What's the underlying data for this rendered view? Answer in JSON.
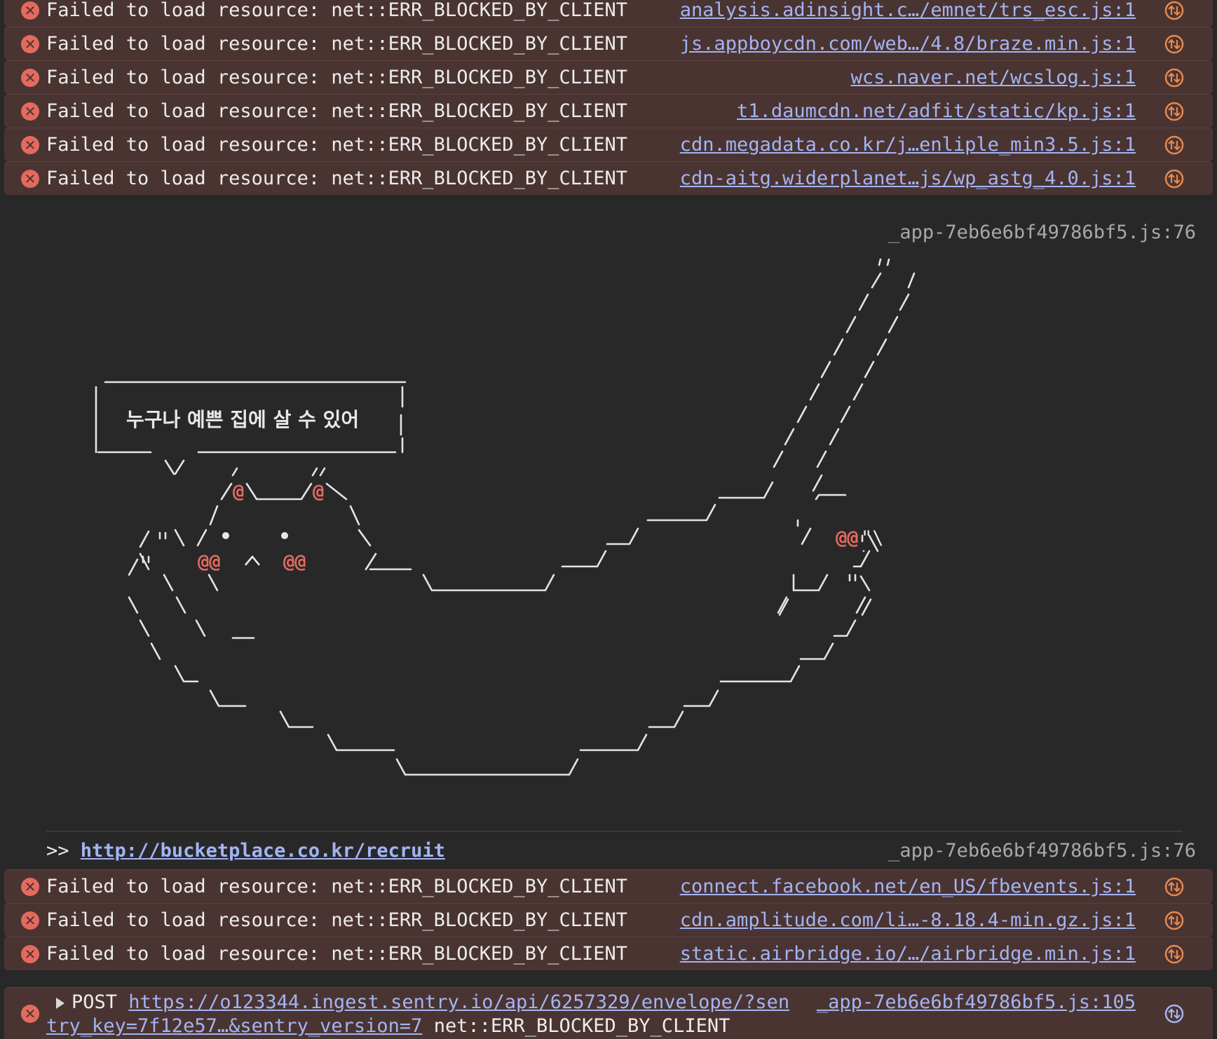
{
  "errors_top": [
    {
      "message": "Failed to load resource: net::ERR_BLOCKED_BY_CLIENT",
      "source": "analysis.adinsight.c…/emnet/trs_esc.js:1"
    },
    {
      "message": "Failed to load resource: net::ERR_BLOCKED_BY_CLIENT",
      "source": "js.appboycdn.com/web…/4.8/braze.min.js:1"
    },
    {
      "message": "Failed to load resource: net::ERR_BLOCKED_BY_CLIENT",
      "source": "wcs.naver.net/wcslog.js:1"
    },
    {
      "message": "Failed to load resource: net::ERR_BLOCKED_BY_CLIENT",
      "source": "t1.daumcdn.net/adfit/static/kp.js:1"
    },
    {
      "message": "Failed to load resource: net::ERR_BLOCKED_BY_CLIENT",
      "source": "cdn.megadata.co.kr/j…enliple_min3.5.js:1"
    },
    {
      "message": "Failed to load resource: net::ERR_BLOCKED_BY_CLIENT",
      "source": "cdn-aitg.widerplanet…js/wp_astg_4.0.js:1"
    }
  ],
  "art_log": {
    "source": "_app-7eb6e6bf49786bf5.js:76",
    "speech_text": "누구나 예쁜 집에 살 수 있어"
  },
  "recruit_log": {
    "prefix": ">>",
    "url": "http://bucketplace.co.kr/recruit",
    "source": "_app-7eb6e6bf49786bf5.js:76"
  },
  "errors_bottom": [
    {
      "message": "Failed to load resource: net::ERR_BLOCKED_BY_CLIENT",
      "source": "connect.facebook.net/en_US/fbevents.js:1"
    },
    {
      "message": "Failed to load resource: net::ERR_BLOCKED_BY_CLIENT",
      "source": "cdn.amplitude.com/li…-8.18.4-min.gz.js:1"
    },
    {
      "message": "Failed to load resource: net::ERR_BLOCKED_BY_CLIENT",
      "source": "static.airbridge.io/…/airbridge.min.js:1"
    }
  ],
  "post_error": {
    "method": "POST",
    "url_line1": "https://o123344.ingest.sentry.io/api/6257329/envelope/?sen",
    "url_line2": "try_key=7f12e57…&sentry_version=7",
    "status": "net::ERR_BLOCKED_BY_CLIENT",
    "source": "_app-7eb6e6bf49786bf5.js:105"
  },
  "colors": {
    "error_bg": "#4a3432",
    "error_icon": "#e46a5e",
    "link": "#a4b4f2",
    "art_accent": "#e46a5e",
    "open_icon": "#e9894c"
  }
}
